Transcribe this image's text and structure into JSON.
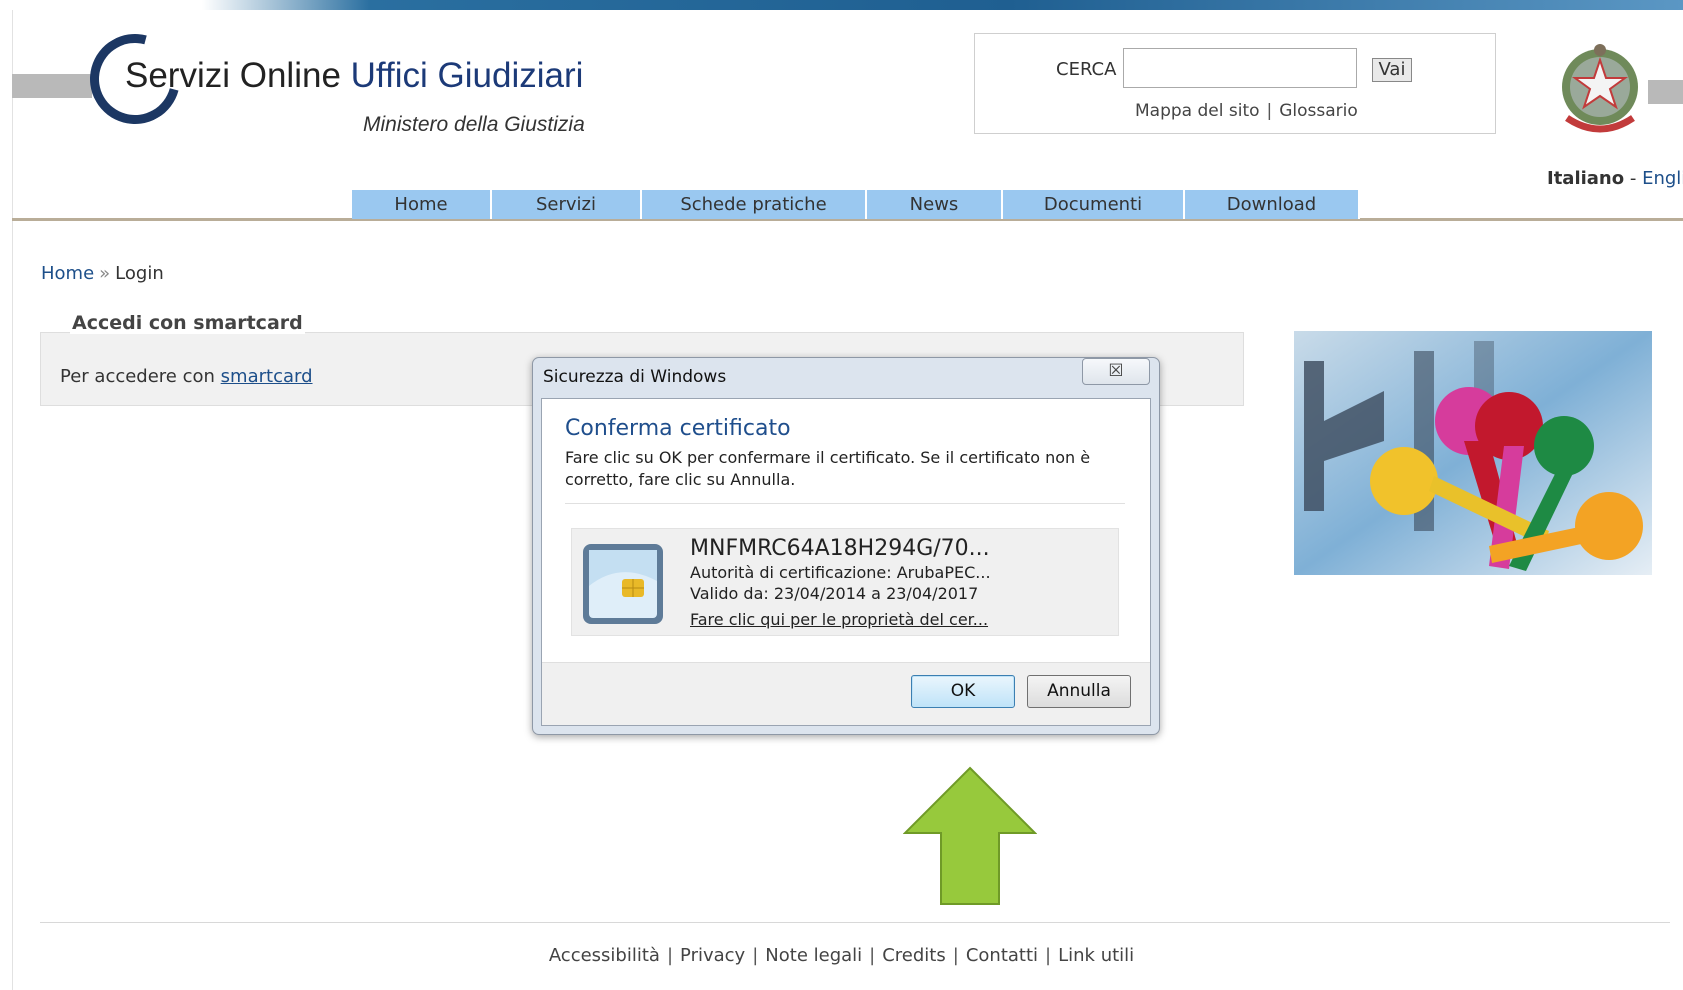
{
  "header": {
    "logo_title_part1": "Servizi Online",
    "logo_title_part2": "Uffici Giudiziari",
    "logo_subtitle": "Ministero della Giustizia",
    "search_label": "CERCA",
    "search_value": "",
    "search_button": "Vai",
    "sitemap_link": "Mappa del sito",
    "glossary_link": "Glossario",
    "sep": "|",
    "lang_active": "Italiano",
    "lang_sep": "-",
    "lang_other": "English"
  },
  "nav": {
    "items": [
      "Home",
      "Servizi",
      "Schede pratiche",
      "News",
      "Documenti",
      "Download"
    ]
  },
  "breadcrumb": {
    "home": "Home",
    "sep": "»",
    "current": "Login"
  },
  "panel": {
    "title": "Accedi con smartcard",
    "text": "Per accedere con",
    "link": "smartcard"
  },
  "dialog": {
    "title": "Sicurezza di Windows",
    "close_glyph": "☒",
    "heading": "Conferma certificato",
    "message": "Fare clic su OK per confermare il certificato. Se il certificato non è corretto, fare clic su Annulla.",
    "cert_name": "MNFMRC64A18H294G/70...",
    "cert_issuer": "Autorità di certificazione: ArubaPEC...",
    "cert_valid": "Valido da: 23/04/2014 a 23/04/2017",
    "cert_link": "Fare clic qui per le proprietà del cer...",
    "ok_button": "OK",
    "cancel_button": "Annulla"
  },
  "footer": {
    "links": [
      "Accessibilità",
      "Privacy",
      "Note legali",
      "Credits",
      "Contatti",
      "Link utili"
    ],
    "sep": "|"
  },
  "colors": {
    "nav_bg": "#9ac8f0",
    "brand_blue": "#1c3a78",
    "link_blue": "#1d4f8a",
    "arrow_green": "#97c93c"
  },
  "icons": {
    "emblem": "italian-republic-emblem-icon",
    "smartcard": "smartcard-icon",
    "arrow": "up-arrow-icon",
    "close": "close-icon"
  }
}
